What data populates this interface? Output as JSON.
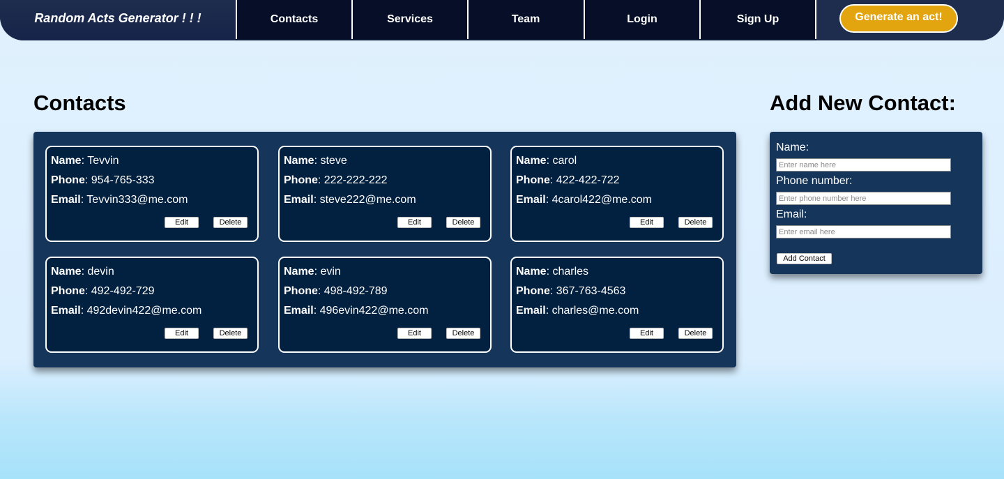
{
  "navbar": {
    "brand": "Random Acts Generator ! ! !",
    "items": [
      "Contacts",
      "Services",
      "Team",
      "Login",
      "Sign Up"
    ],
    "cta": "Generate an act!"
  },
  "contacts": {
    "heading": "Contacts",
    "name_label": "Name",
    "phone_label": "Phone",
    "email_label": "Email",
    "edit_label": "Edit",
    "delete_label": "Delete",
    "list": [
      {
        "name": "Tevvin",
        "phone": "954-765-333",
        "email": "Tevvin333@me.com"
      },
      {
        "name": "steve",
        "phone": "222-222-222",
        "email": "steve222@me.com"
      },
      {
        "name": "carol",
        "phone": "422-422-722",
        "email": "4carol422@me.com"
      },
      {
        "name": "devin",
        "phone": "492-492-729",
        "email": "492devin422@me.com"
      },
      {
        "name": "evin",
        "phone": "498-492-789",
        "email": "496evin422@me.com"
      },
      {
        "name": "charles",
        "phone": "367-763-4563",
        "email": "charles@me.com"
      }
    ]
  },
  "form": {
    "heading": "Add New Contact:",
    "name_label": "Name:",
    "name_placeholder": "Enter name here",
    "phone_label": "Phone number:",
    "phone_placeholder": "Enter phone number here",
    "email_label": "Email:",
    "email_placeholder": "Enter email here",
    "submit_label": "Add Contact"
  },
  "colors": {
    "navbar": "#0b1733",
    "cta": "#e2a40f",
    "panel": "#16355a",
    "card": "#02203f"
  }
}
